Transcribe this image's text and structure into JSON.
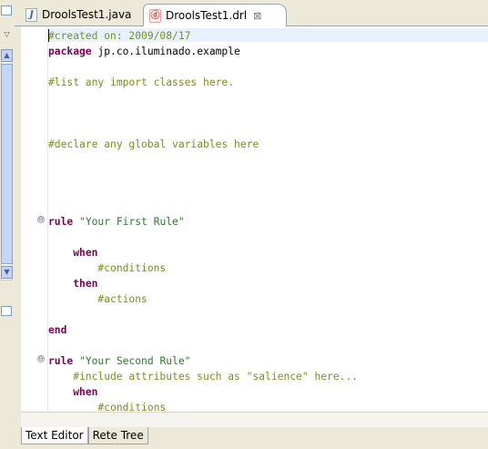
{
  "tabs": [
    {
      "label": "DroolsTest1.java",
      "icon": "java-file-icon"
    },
    {
      "label": "DroolsTest1.drl",
      "icon": "drools-file-icon",
      "active": true
    }
  ],
  "editor": {
    "lines": [
      [
        {
          "t": "#created on: 2009/08/17",
          "c": "cm"
        }
      ],
      [
        {
          "t": "package",
          "c": "kw"
        },
        {
          "t": " jp.co.iluminado.example",
          "c": ""
        }
      ],
      [],
      [
        {
          "t": "#list any import classes here.",
          "c": "cm"
        }
      ],
      [],
      [],
      [],
      [
        {
          "t": "#declare any global variables here",
          "c": "cm"
        }
      ],
      [],
      [],
      [],
      [],
      [
        {
          "t": "rule",
          "c": "kw"
        },
        {
          "t": " ",
          "c": ""
        },
        {
          "t": "\"Your First Rule\"",
          "c": "st"
        }
      ],
      [],
      [
        {
          "t": "    ",
          "c": ""
        },
        {
          "t": "when",
          "c": "kw"
        }
      ],
      [
        {
          "t": "        #conditions",
          "c": "cm"
        }
      ],
      [
        {
          "t": "    ",
          "c": ""
        },
        {
          "t": "then",
          "c": "kw"
        }
      ],
      [
        {
          "t": "        #actions",
          "c": "cm"
        }
      ],
      [],
      [
        {
          "t": "end",
          "c": "kw"
        }
      ],
      [],
      [
        {
          "t": "rule",
          "c": "kw"
        },
        {
          "t": " ",
          "c": ""
        },
        {
          "t": "\"Your Second Rule\"",
          "c": "st"
        }
      ],
      [
        {
          "t": "    #include attributes such as \"salience\" here...",
          "c": "cm"
        }
      ],
      [
        {
          "t": "    ",
          "c": ""
        },
        {
          "t": "when",
          "c": "kw"
        }
      ],
      [
        {
          "t": "        #conditions",
          "c": "cm"
        }
      ]
    ],
    "fold_markers": [
      "⊖",
      "⊖"
    ],
    "close_glyph": "⊠"
  },
  "bottom_tabs": [
    {
      "label": "Text Editor",
      "active": true
    },
    {
      "label": "Rete Tree",
      "active": false
    }
  ]
}
